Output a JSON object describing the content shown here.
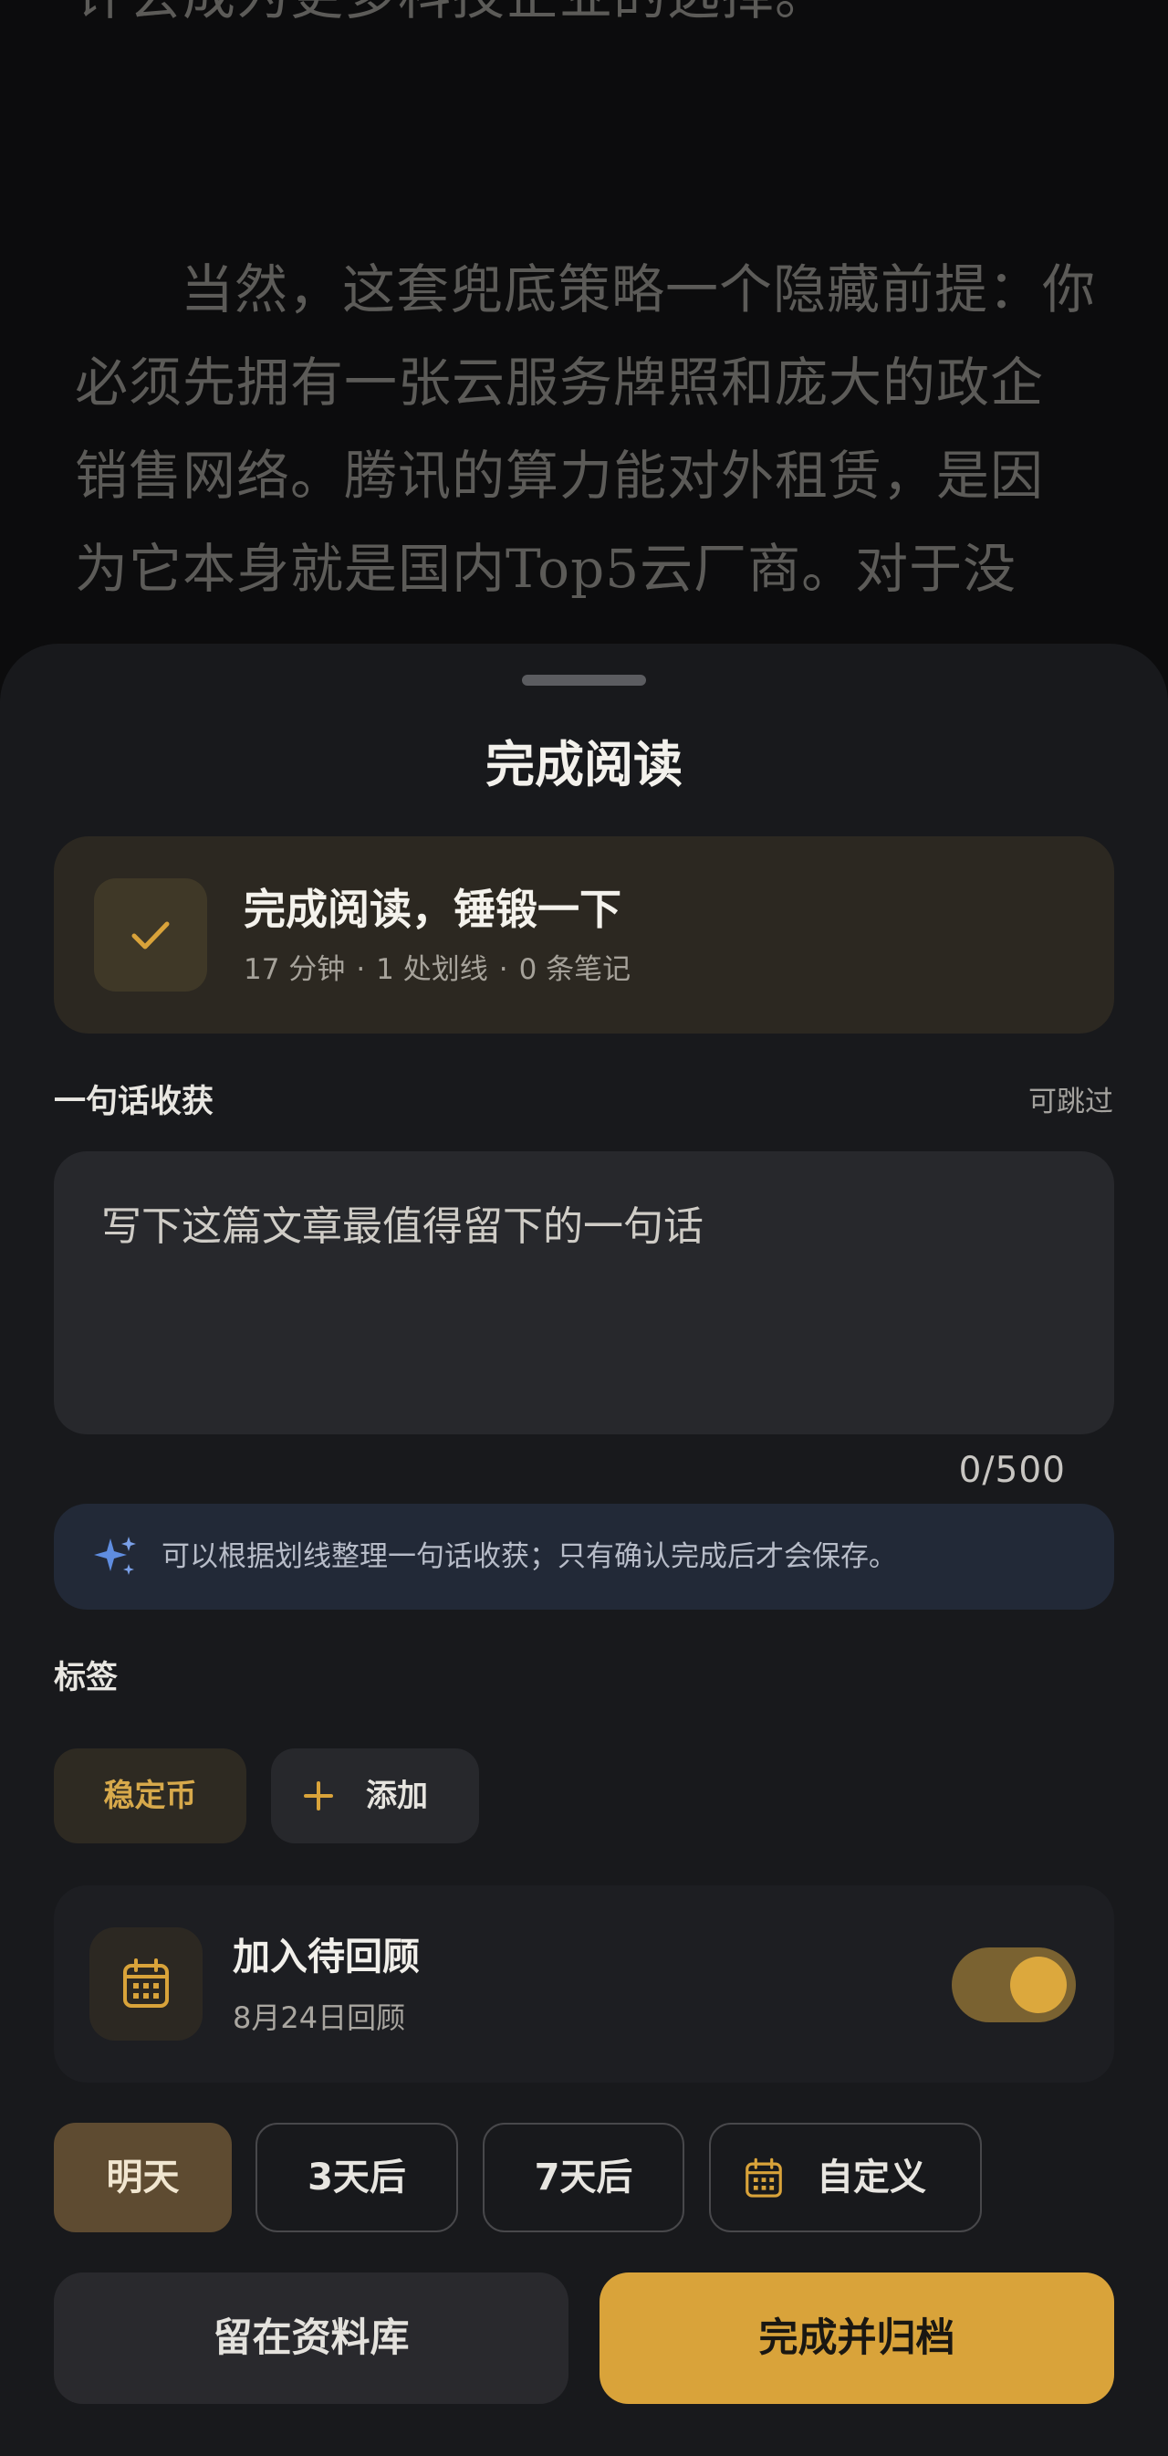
{
  "article": {
    "paragraph1": "许会成为更多科技企业的选择。",
    "paragraph2": "当然，这套兜底策略一个隐藏前提：你必须先拥有一张云服务牌照和庞大的政企销售网络。腾讯的算力能对外租赁，是因为它本身就是国内Top5云厂商。对于没"
  },
  "sheet": {
    "title": "完成阅读",
    "summary": {
      "icon": "check-icon",
      "title": "完成阅读，锤锻一下",
      "duration": "17 分钟",
      "highlights": "1 处划线",
      "notes": "0 条笔记",
      "separator": "·"
    },
    "takeaway": {
      "label": "一句话收获",
      "skip": "可跳过",
      "placeholder": "写下这篇文章最值得留下的一句话",
      "value": "",
      "count": "0/500"
    },
    "hint": {
      "icon": "sparkle-icon",
      "text": "可以根据划线整理一句话收获；只有确认完成后才会保存。"
    },
    "tags": {
      "label": "标签",
      "items": [
        "稳定币"
      ],
      "add_label": "添加"
    },
    "review": {
      "icon": "calendar-icon",
      "title": "加入待回顾",
      "date": "8月24日回顾",
      "enabled": true
    },
    "date_options": {
      "tomorrow": "明天",
      "three_days": "3天后",
      "seven_days": "7天后",
      "custom": "自定义",
      "selected": "明天"
    },
    "actions": {
      "secondary": "留在资料库",
      "primary": "完成并归档"
    }
  },
  "colors": {
    "accent": "#d9a33a",
    "sheet_bg": "#18191c",
    "card_bg": "#2c2821",
    "hint_bg": "#222937"
  }
}
